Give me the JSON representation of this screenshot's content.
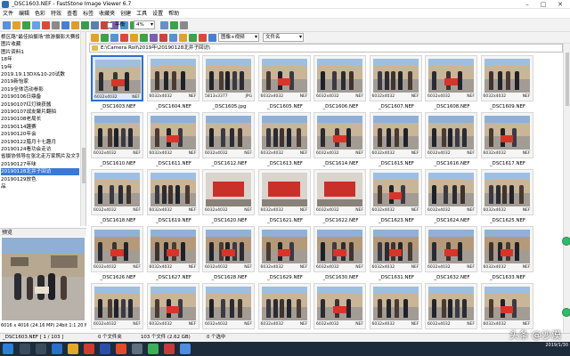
{
  "window": {
    "title": "_DSC1603.NEF - FastStone Image Viewer 6.7",
    "minimize_icon": "minimize-icon",
    "maximize_icon": "maximize-icon",
    "close_icon": "close-icon"
  },
  "menu": [
    "文件",
    "编辑",
    "色彩",
    "特效",
    "查看",
    "标签",
    "收藏夹",
    "创建",
    "工具",
    "设置",
    "帮助"
  ],
  "toolbar": {
    "checkbox_label": "平衡",
    "zoom_value": "4%",
    "sort_value": "图像+视频",
    "filename_value": "文件名"
  },
  "tree": [
    {
      "label": "根区路\"最佳拍摄场\"旅游摄影大赛投稿",
      "selected": false
    },
    {
      "label": "图片收藏",
      "selected": false
    },
    {
      "label": "图片资料1",
      "selected": false
    },
    {
      "label": "18年",
      "selected": false
    },
    {
      "label": "19年",
      "selected": false
    },
    {
      "label": "2019.19.13DX&10-20试数",
      "selected": false
    },
    {
      "label": "2019新怡家",
      "selected": false
    },
    {
      "label": "2019全体活动参影",
      "selected": false
    },
    {
      "label": "20190106日鼎备",
      "selected": false
    },
    {
      "label": "20190107红灯映获酱",
      "selected": false
    },
    {
      "label": "20190107战友聚片翻拍",
      "selected": false
    },
    {
      "label": "20190108老局长",
      "selected": false
    },
    {
      "label": "20190114趣赛",
      "selected": false
    },
    {
      "label": "20190120年会",
      "selected": false
    },
    {
      "label": "20190122腊月十七趣月",
      "selected": false
    },
    {
      "label": "20190124看功会走访",
      "selected": false
    },
    {
      "label": "省摄协领导在张北走万家照片及文字",
      "selected": false
    },
    {
      "label": "20190127年味",
      "selected": false
    },
    {
      "label": "20190128北井子回访",
      "selected": true
    },
    {
      "label": "20190129放色",
      "selected": false
    },
    {
      "label": "品",
      "selected": false
    }
  ],
  "preview": {
    "label": "预览",
    "info": "6016 x 4016 (24.16 MP)  24bit  1:1  20 MB  2019-01"
  },
  "path": "E:\\Camera Roll\\2019年\\20190128北井子回访\\",
  "thumbnails": [
    {
      "name": "_DSC1603.NEF",
      "dims": "6032x4032",
      "ext": "NEF",
      "selected": true,
      "kind": "outdoor"
    },
    {
      "name": "_DSC1604.NEF",
      "dims": "6032x4032",
      "ext": "NEF",
      "selected": false,
      "kind": "outdoor"
    },
    {
      "name": "_DSC1605.jpg",
      "dims": "5813x3377",
      "ext": "JPG",
      "selected": false,
      "kind": "outdoor"
    },
    {
      "name": "_DSC1605.NEF",
      "dims": "6032x4032",
      "ext": "NEF",
      "selected": false,
      "kind": "outdoor"
    },
    {
      "name": "_DSC1606.NEF",
      "dims": "6032x4032",
      "ext": "NEF",
      "selected": false,
      "kind": "outdoor"
    },
    {
      "name": "_DSC1607.NEF",
      "dims": "6032x4032",
      "ext": "NEF",
      "selected": false,
      "kind": "outdoor"
    },
    {
      "name": "_DSC1608.NEF",
      "dims": "6032x4032",
      "ext": "NEF",
      "selected": false,
      "kind": "outdoor"
    },
    {
      "name": "_DSC1609.NEF",
      "dims": "6032x4032",
      "ext": "NEF",
      "selected": false,
      "kind": "outdoor"
    },
    {
      "name": "_DSC1610.NEF",
      "dims": "6032x4032",
      "ext": "NEF",
      "selected": false,
      "kind": "outdoor"
    },
    {
      "name": "_DSC1611.NEF",
      "dims": "6032x4032",
      "ext": "NEF",
      "selected": false,
      "kind": "outdoor"
    },
    {
      "name": "_DSC1612.NEF",
      "dims": "6032x4032",
      "ext": "NEF",
      "selected": false,
      "kind": "outdoor"
    },
    {
      "name": "_DSC1613.NEF",
      "dims": "6032x4032",
      "ext": "NEF",
      "selected": false,
      "kind": "outdoor"
    },
    {
      "name": "_DSC1614.NEF",
      "dims": "6032x4032",
      "ext": "NEF",
      "selected": false,
      "kind": "outdoor"
    },
    {
      "name": "_DSC1615.NEF",
      "dims": "6032x4032",
      "ext": "NEF",
      "selected": false,
      "kind": "outdoor"
    },
    {
      "name": "_DSC1616.NEF",
      "dims": "6032x4032",
      "ext": "NEF",
      "selected": false,
      "kind": "outdoor"
    },
    {
      "name": "_DSC1617.NEF",
      "dims": "6032x4032",
      "ext": "NEF",
      "selected": false,
      "kind": "outdoor"
    },
    {
      "name": "_DSC1618.NEF",
      "dims": "6032x4032",
      "ext": "NEF",
      "selected": false,
      "kind": "outdoor"
    },
    {
      "name": "_DSC1619.NEF",
      "dims": "6032x4032",
      "ext": "NEF",
      "selected": false,
      "kind": "outdoor"
    },
    {
      "name": "_DSC1620.NEF",
      "dims": "6032x4032",
      "ext": "NEF",
      "selected": false,
      "kind": "indoor"
    },
    {
      "name": "_DSC1621.NEF",
      "dims": "6032x4032",
      "ext": "NEF",
      "selected": false,
      "kind": "indoor"
    },
    {
      "name": "_DSC1622.NEF",
      "dims": "6032x4032",
      "ext": "NEF",
      "selected": false,
      "kind": "indoor"
    },
    {
      "name": "_DSC1623.NEF",
      "dims": "6032x4032",
      "ext": "NEF",
      "selected": false,
      "kind": "outdoor"
    },
    {
      "name": "_DSC1624.NEF",
      "dims": "6032x4032",
      "ext": "NEF",
      "selected": false,
      "kind": "outdoor"
    },
    {
      "name": "_DSC1625.NEF",
      "dims": "6032x4032",
      "ext": "NEF",
      "selected": false,
      "kind": "outdoor"
    },
    {
      "name": "_DSC1626.NEF",
      "dims": "6032x4032",
      "ext": "NEF",
      "selected": false,
      "kind": "banner"
    },
    {
      "name": "_DSC1627.NEF",
      "dims": "6032x4032",
      "ext": "NEF",
      "selected": false,
      "kind": "banner"
    },
    {
      "name": "_DSC1628.NEF",
      "dims": "6032x4032",
      "ext": "NEF",
      "selected": false,
      "kind": "banner"
    },
    {
      "name": "_DSC1629.NEF",
      "dims": "6032x4032",
      "ext": "NEF",
      "selected": false,
      "kind": "banner"
    },
    {
      "name": "_DSC1630.NEF",
      "dims": "6032x4032",
      "ext": "NEF",
      "selected": false,
      "kind": "banner"
    },
    {
      "name": "_DSC1631.NEF",
      "dims": "6032x4032",
      "ext": "NEF",
      "selected": false,
      "kind": "banner"
    },
    {
      "name": "_DSC1632.NEF",
      "dims": "6032x4032",
      "ext": "NEF",
      "selected": false,
      "kind": "banner"
    },
    {
      "name": "_DSC1633.NEF",
      "dims": "6032x4032",
      "ext": "NEF",
      "selected": false,
      "kind": "banner"
    },
    {
      "name": "",
      "dims": "6032x4032",
      "ext": "NEF",
      "selected": false,
      "kind": "outdoor"
    },
    {
      "name": "",
      "dims": "6032x4032",
      "ext": "NEF",
      "selected": false,
      "kind": "outdoor"
    },
    {
      "name": "",
      "dims": "6032x4032",
      "ext": "NEF",
      "selected": false,
      "kind": "outdoor"
    },
    {
      "name": "",
      "dims": "6032x4032",
      "ext": "NEF",
      "selected": false,
      "kind": "outdoor"
    },
    {
      "name": "",
      "dims": "6032x4032",
      "ext": "NEF",
      "selected": false,
      "kind": "outdoor"
    },
    {
      "name": "",
      "dims": "6032x4032",
      "ext": "NEF",
      "selected": false,
      "kind": "outdoor"
    },
    {
      "name": "",
      "dims": "6032x4032",
      "ext": "NEF",
      "selected": false,
      "kind": "outdoor"
    },
    {
      "name": "",
      "dims": "6032x4032",
      "ext": "NEF",
      "selected": false,
      "kind": "outdoor"
    }
  ],
  "status": {
    "file": "_DSC1603.NEF [ 1 / 103 ]",
    "folders": "0 个文件夹",
    "files": "103 个文件 (2.62 GB)",
    "selected": "0 个选中"
  },
  "taskbar": {
    "time": "",
    "date": "2019/1/30"
  },
  "watermark": "头条 @沙漠"
}
